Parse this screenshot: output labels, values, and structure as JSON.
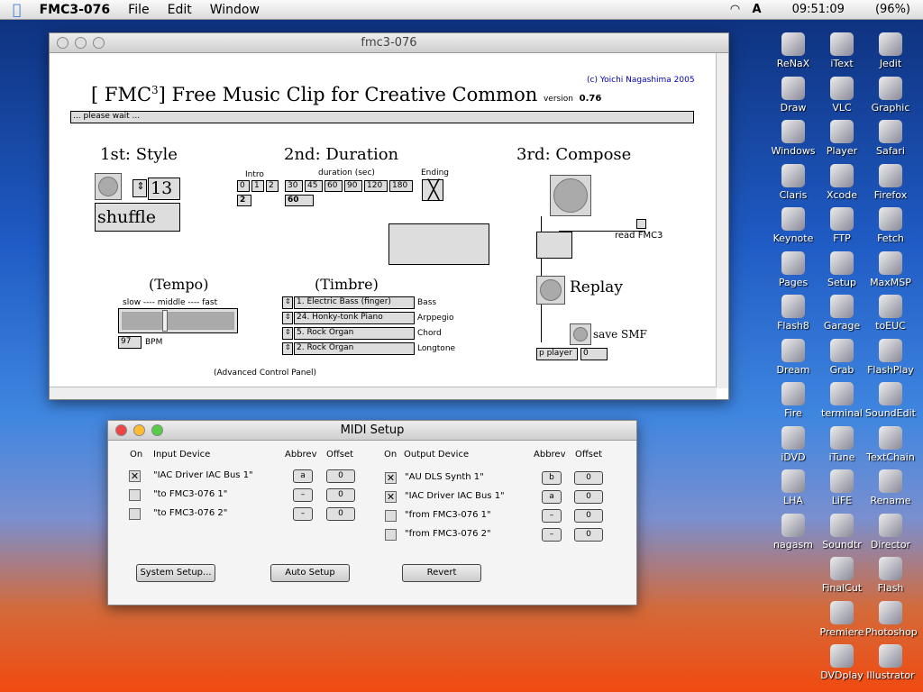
{
  "menubar": {
    "app": "FMC3-076",
    "menus": [
      "File",
      "Edit",
      "Window"
    ],
    "clock": "09:51:09",
    "battery": "(96%)"
  },
  "main": {
    "title": "fmc3-076",
    "copyright": "(c) Yoichi Nagashima 2005",
    "heading": "[ FMC",
    "sup": "3",
    "heading2": "] Free Music Clip for Creative Common",
    "version_label": "version",
    "version": "0.76",
    "status": "... please wait ...",
    "style": {
      "title": "1st: Style",
      "number": "13",
      "name": "shuffle"
    },
    "duration": {
      "title": "2nd: Duration",
      "intro_label": "Intro",
      "intro_opts": [
        "0",
        "1",
        "2"
      ],
      "intro_val": "2",
      "dur_label": "duration (sec)",
      "dur_opts": [
        "30",
        "45",
        "60",
        "90",
        "120",
        "180"
      ],
      "dur_val": "60",
      "ending_label": "Ending"
    },
    "compose": {
      "title": "3rd: Compose",
      "read": "read FMC3",
      "replay": "Replay",
      "save": "save SMF",
      "player": "p player",
      "player_val": "0"
    },
    "tempo": {
      "title": "(Tempo)",
      "scale": "slow ---- middle ---- fast",
      "bpm": "97",
      "bpm_label": "BPM",
      "slider_fraction": 0.36
    },
    "timbre": {
      "title": "(Timbre)",
      "rows": [
        {
          "v": "1. Electric Bass (finger)",
          "p": "Bass"
        },
        {
          "v": "24. Honky-tonk Piano",
          "p": "Arppegio"
        },
        {
          "v": "5. Rock Organ",
          "p": "Chord"
        },
        {
          "v": "2. Rock Organ",
          "p": "Longtone"
        }
      ]
    },
    "advanced": "(Advanced Control Panel)"
  },
  "midi": {
    "title": "MIDI Setup",
    "h_on": "On",
    "h_in": "Input Device",
    "h_abbrev": "Abbrev",
    "h_offset": "Offset",
    "h_out": "Output Device",
    "inputs": [
      {
        "on": true,
        "name": "\"IAC Driver IAC Bus 1\"",
        "abbrev": "a",
        "offset": "0"
      },
      {
        "on": false,
        "name": "\"to FMC3-076 1\"",
        "abbrev": "–",
        "offset": "0"
      },
      {
        "on": false,
        "name": "\"to FMC3-076 2\"",
        "abbrev": "–",
        "offset": "0"
      }
    ],
    "outputs": [
      {
        "on": true,
        "name": "\"AU DLS Synth 1\"",
        "abbrev": "b",
        "offset": "0"
      },
      {
        "on": true,
        "name": "\"IAC Driver IAC Bus 1\"",
        "abbrev": "a",
        "offset": "0"
      },
      {
        "on": false,
        "name": "\"from FMC3-076 1\"",
        "abbrev": "–",
        "offset": "0"
      },
      {
        "on": false,
        "name": "\"from FMC3-076 2\"",
        "abbrev": "–",
        "offset": "0"
      }
    ],
    "buttons": [
      "System Setup...",
      "Auto Setup",
      "Revert"
    ]
  },
  "desktop": [
    [
      "ReNaX",
      "Draw",
      "Windows",
      "Claris",
      "Keynote",
      "Pages",
      "Flash8",
      "Dream",
      "Fire",
      "iDVD",
      "LHA",
      "nagasm"
    ],
    [
      "iText",
      "VLC",
      "Player",
      "Xcode",
      "FTP",
      "Setup",
      "Garage",
      "Grab",
      "terminal",
      "iTune",
      "LiFE",
      "Soundtr",
      "FinalCut",
      "Premiere",
      "DVDplay"
    ],
    [
      "Jedit",
      "Graphic",
      "Safari",
      "Firefox",
      "Fetch",
      "MaxMSP",
      "toEUC",
      "FlashPlay",
      "SoundEdit",
      "TextChain",
      "Rename",
      "Director",
      "Flash",
      "Photoshop",
      "Illustrator"
    ]
  ]
}
